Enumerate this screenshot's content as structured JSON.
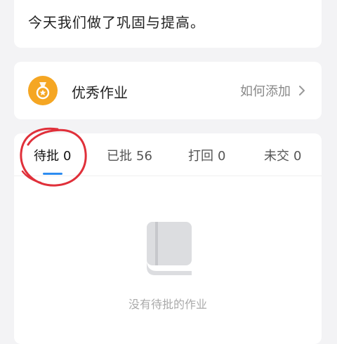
{
  "notice": {
    "text": "今天我们做了巩固与提高。"
  },
  "excellent": {
    "icon": "medal-icon",
    "title": "优秀作业",
    "link_label": "如何添加",
    "accent": "#f5a623"
  },
  "tabs": [
    {
      "label": "待批",
      "count": "0",
      "active": true
    },
    {
      "label": "已批",
      "count": "56",
      "active": false
    },
    {
      "label": "打回",
      "count": "0",
      "active": false
    },
    {
      "label": "未交",
      "count": "0",
      "active": false
    }
  ],
  "tab_accent": "#2d8cf0",
  "annotation_color": "#e0303a",
  "empty": {
    "icon": "book-icon",
    "text": "没有待批的作业"
  }
}
